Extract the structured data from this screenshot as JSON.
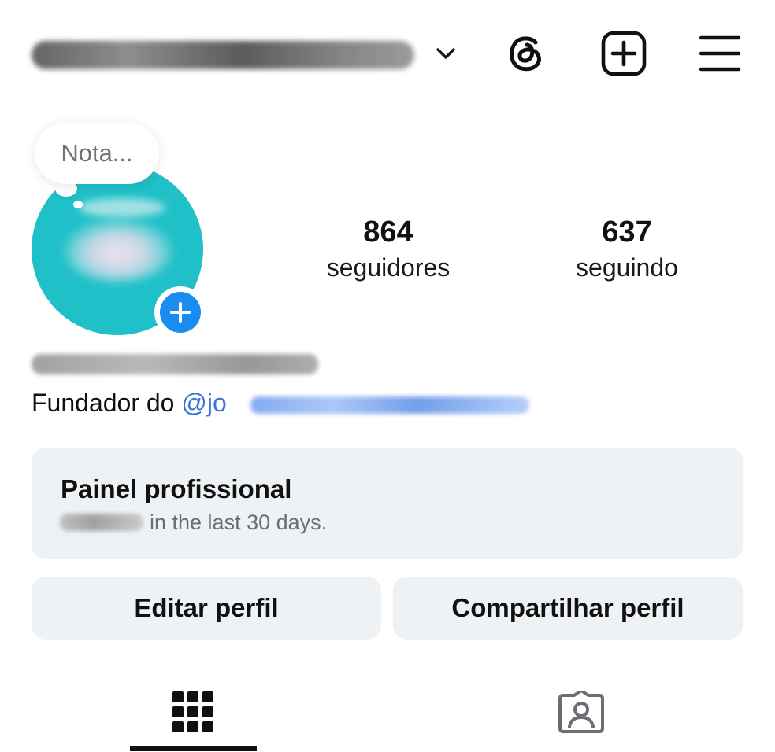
{
  "header": {
    "username": "",
    "icons": [
      "chevron-down-icon",
      "threads-icon",
      "create-icon",
      "menu-icon"
    ]
  },
  "profile": {
    "note_placeholder": "Nota...",
    "followers_count": "864",
    "followers_label": "seguidores",
    "following_count": "637",
    "following_label": "seguindo",
    "bio_text": "Fundador do ",
    "bio_mention": "@jo"
  },
  "dashboard": {
    "title": "Painel profissional",
    "subtitle": "in the last 30 days."
  },
  "actions": {
    "edit_label": "Editar perfil",
    "share_label": "Compartilhar perfil"
  },
  "tabs": [
    {
      "name": "posts-grid",
      "icon": "grid-icon",
      "selected": true
    },
    {
      "name": "tagged",
      "icon": "tagged-icon",
      "selected": false
    }
  ],
  "colors": {
    "accent": "#1a8cf0",
    "mention": "#3b74d8",
    "avatar_bg": "#1fc0c8",
    "panel_bg": "#eff2f5"
  }
}
